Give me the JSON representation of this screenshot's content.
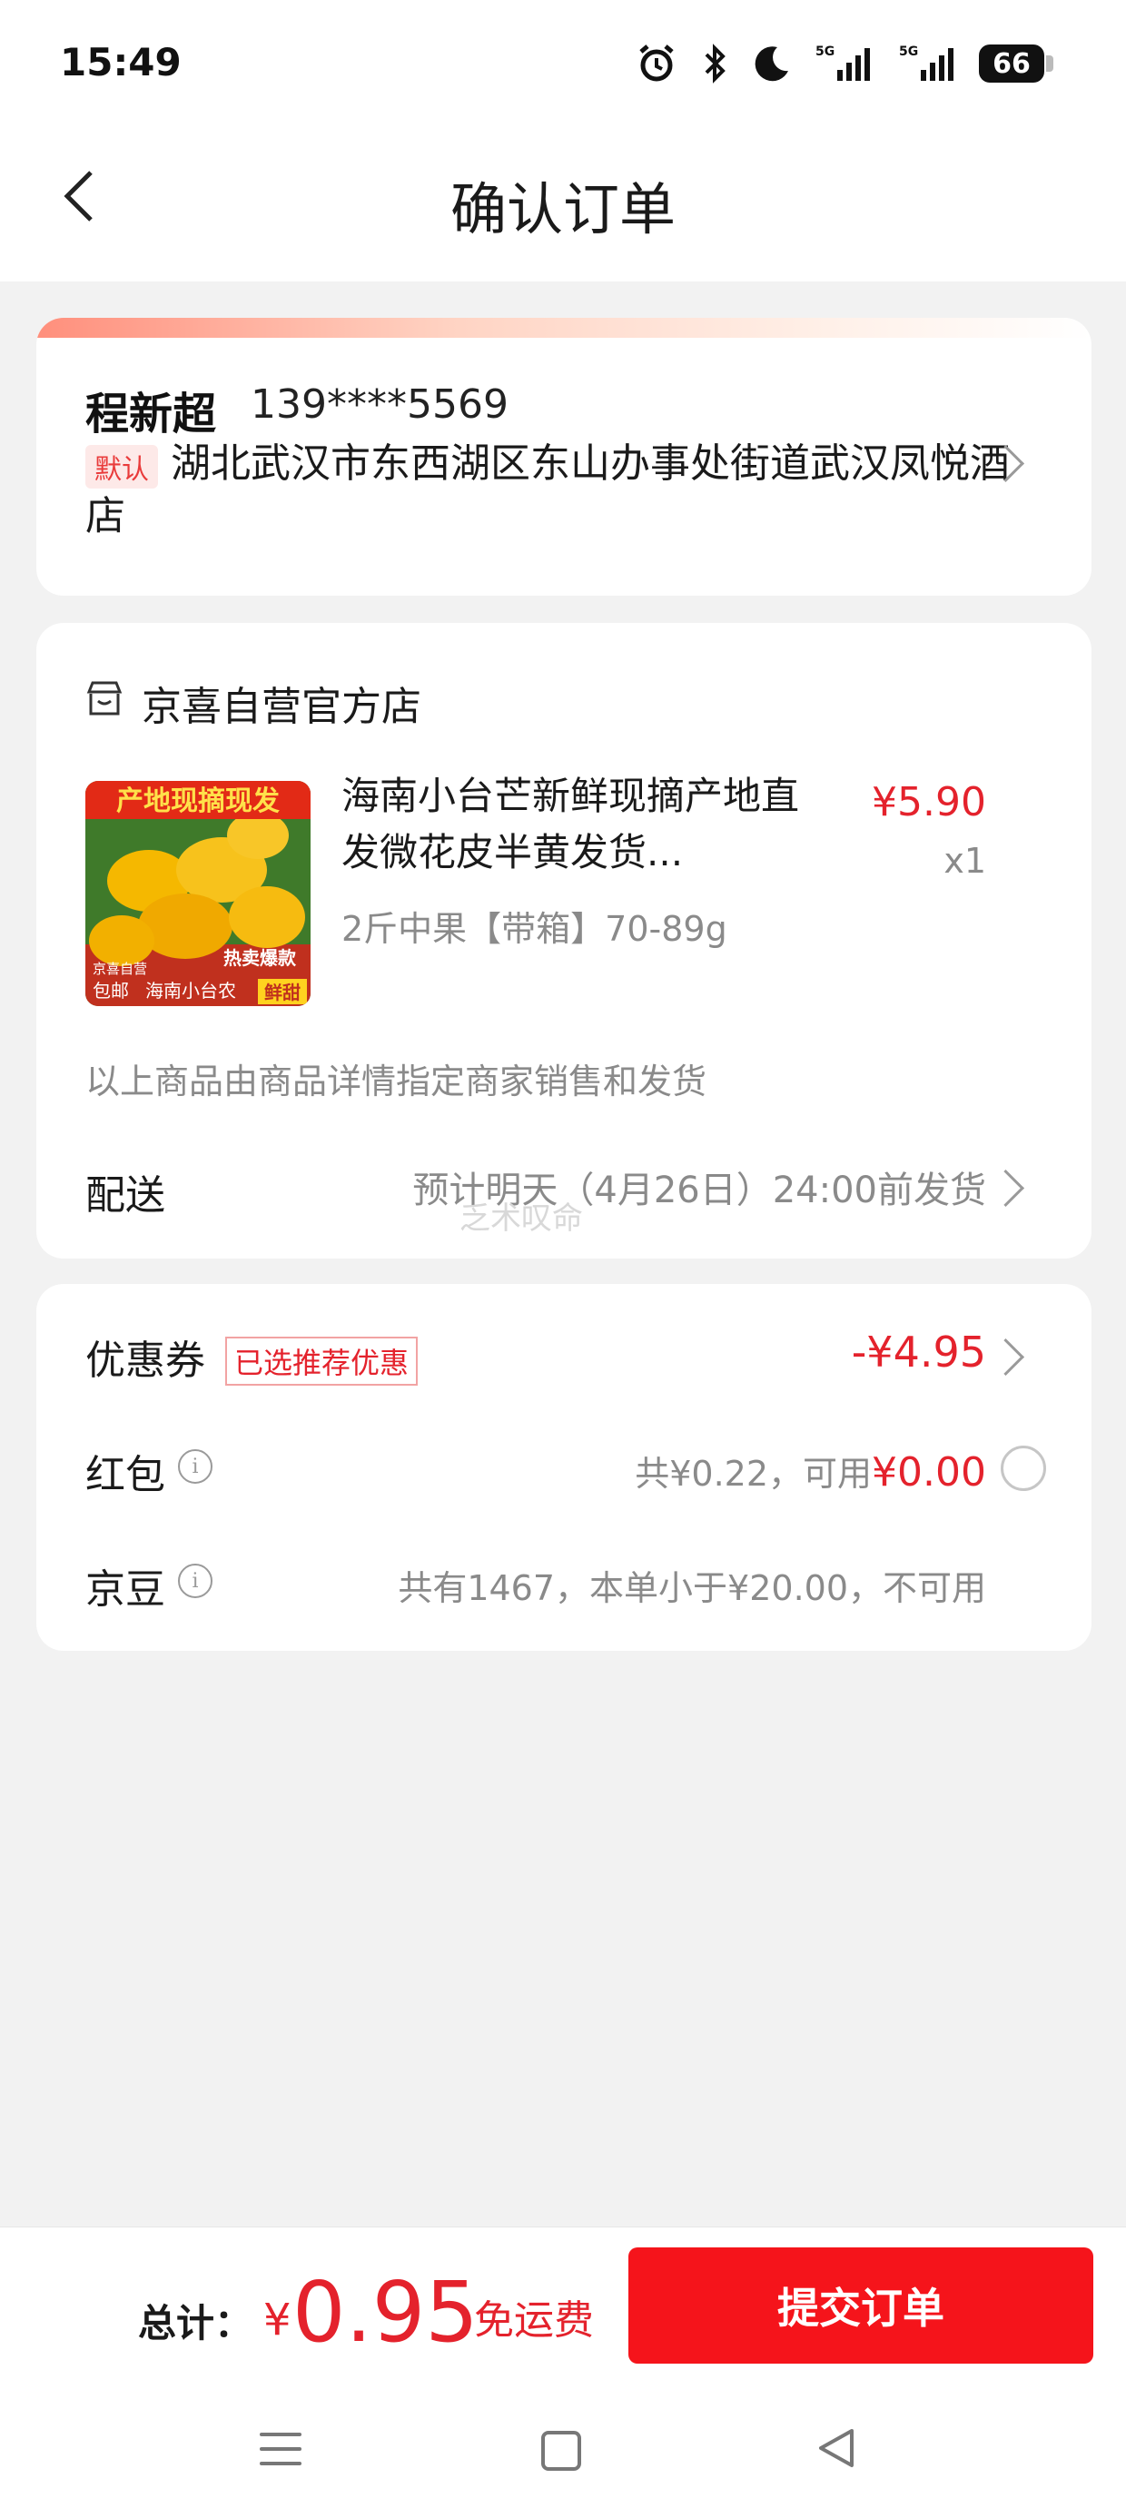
{
  "status_bar": {
    "time": "15:49",
    "battery": "66"
  },
  "header": {
    "title": "确认订单"
  },
  "address": {
    "name": "程新超",
    "phone": "139****5569",
    "default_tag": "默认",
    "line": "湖北武汉市东西湖区东山办事处街道武汉凤悦酒店"
  },
  "store": {
    "name": "京喜自营官方店",
    "product": {
      "title": "海南小台芒新鲜现摘产地直发微花皮半黄发货...",
      "price": "¥5.90",
      "quantity": "x1",
      "spec": "2斤中果【带箱】70-89g",
      "image_text": {
        "top_banner": "产地现摘现发",
        "badge_hot": "热卖爆款",
        "badge_self": "京喜自营",
        "badge_free": "包邮",
        "badge_origin": "海南小台农",
        "badge_sweet": "鲜甜"
      }
    },
    "seller_note": "以上商品由商品详情指定商家销售和发货",
    "shipping": {
      "label": "配送",
      "value": "预计明天（4月26日）24:00前发货"
    },
    "watermark": "乏术叹命"
  },
  "discounts": {
    "coupon": {
      "label": "优惠券",
      "tag": "已选推荐优惠",
      "value": "-¥4.95"
    },
    "red_packet": {
      "label": "红包",
      "text": "共¥0.22，可用",
      "value": "¥0.00"
    },
    "jd_bean": {
      "label": "京豆",
      "text": "共有1467，本单小于¥20.00，不可用"
    }
  },
  "footer": {
    "total_label": "总计：",
    "currency": "¥",
    "total_amount": "0.95",
    "free_shipping": "免运费",
    "submit_label": "提交订单"
  },
  "colors": {
    "accent": "#e4222c",
    "button": "#f5141b",
    "background": "#f2f2f2"
  }
}
